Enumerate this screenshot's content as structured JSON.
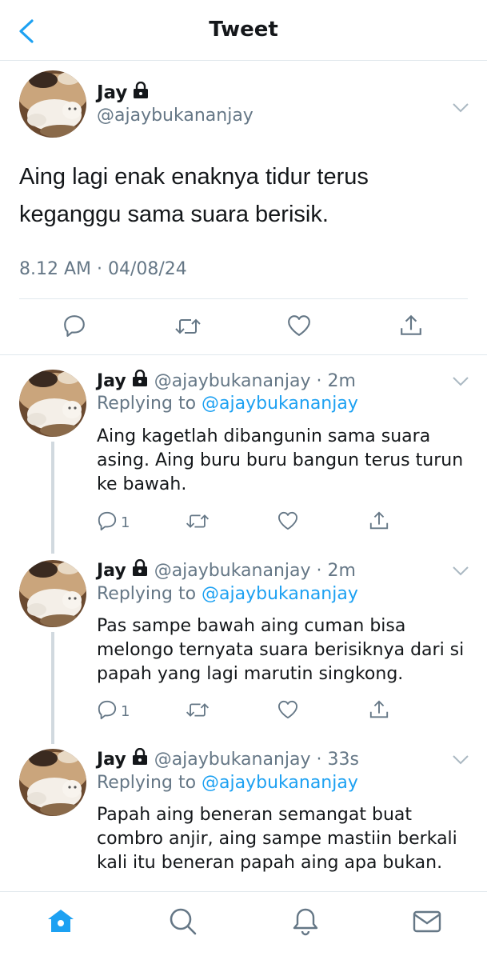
{
  "header": {
    "title": "Tweet"
  },
  "main_tweet": {
    "name": "Jay",
    "handle": "@ajaybukananjay",
    "text": "Aing lagi enak enaknya tidur terus keganggu sama suara berisik.",
    "timestamp": "8.12 AM · 04/08/24"
  },
  "replies": [
    {
      "name": "Jay",
      "handle_time": "@ajaybukananjay · 2m",
      "replying_prefix": "Replying to ",
      "replying_to": "@ajaybukananjay",
      "text": "Aing kagetlah dibangunin sama suara asing. Aing buru buru bangun terus turun ke bawah.",
      "reply_count": "1"
    },
    {
      "name": "Jay",
      "handle_time": "@ajaybukananjay · 2m",
      "replying_prefix": "Replying to ",
      "replying_to": "@ajaybukananjay",
      "text": "Pas sampe bawah aing cuman bisa melongo ternyata suara berisiknya dari si papah yang lagi marutin singkong.",
      "reply_count": "1"
    },
    {
      "name": "Jay",
      "handle_time": "@ajaybukananjay · 33s",
      "replying_prefix": "Replying to ",
      "replying_to": "@ajaybukananjay",
      "text": "Papah aing beneran semangat buat combro anjir, aing sampe mastiin berkali kali itu beneran papah aing apa bukan."
    }
  ],
  "colors": {
    "accent": "#1da1f2",
    "muted": "#657786",
    "text": "#14171a",
    "divider": "#e1e8ed"
  },
  "icons": [
    "back-arrow",
    "lock",
    "chevron-down",
    "reply",
    "retweet",
    "like",
    "share",
    "home",
    "search",
    "notifications",
    "messages"
  ]
}
